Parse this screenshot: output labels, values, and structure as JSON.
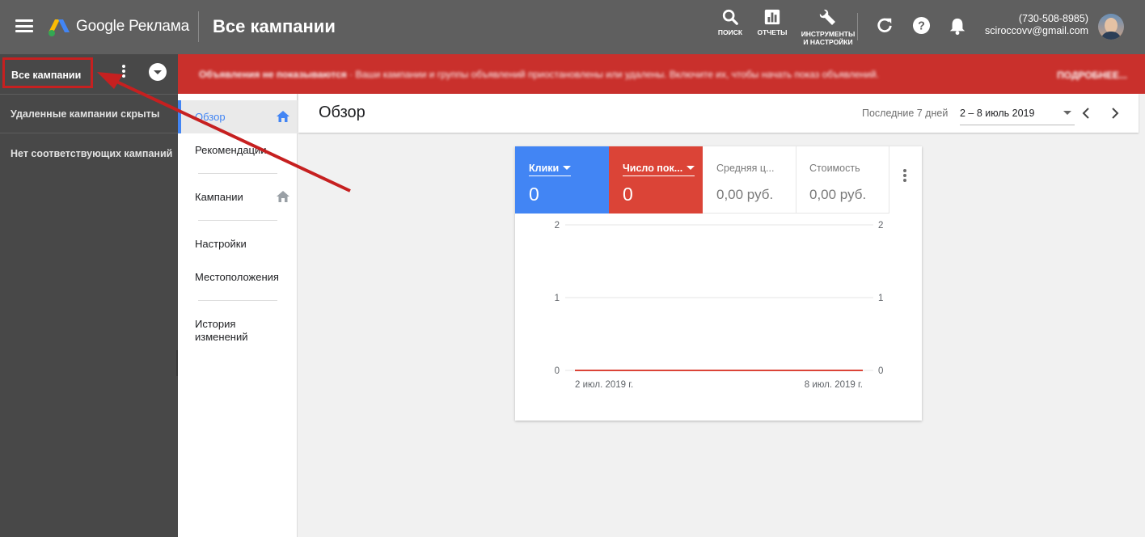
{
  "header": {
    "brand": "Google Реклама",
    "page_title": "Все кампании",
    "tools": [
      {
        "label": "ПОИСК",
        "icon": "search-icon"
      },
      {
        "label": "ОТЧЕТЫ",
        "icon": "reports-icon"
      },
      {
        "label": "ИНСТРУМЕНТЫ\nИ НАСТРОЙКИ",
        "icon": "wrench-icon"
      }
    ],
    "icons": [
      "refresh-icon",
      "help-icon",
      "notifications-icon"
    ],
    "account": {
      "phone": "(730-508-8985)",
      "email": "sciroccovv@gmail.com"
    }
  },
  "sidebar": {
    "selector_label": "Все кампании",
    "notes": [
      "Удаленные кампании скрыты",
      "Нет соответствующих кампаний"
    ]
  },
  "alert": {
    "title": "Объявления не показываются",
    "message": "· Ваши кампании и группы объявлений приостановлены или удалены. Включите их, чтобы начать показ объявлений.",
    "action": "ПОДРОБНЕЕ..."
  },
  "nav": {
    "items": [
      {
        "label": "Обзор",
        "active": true
      },
      {
        "label": "Рекомендации"
      },
      {
        "label": "Кампании"
      },
      {
        "label": "Настройки"
      },
      {
        "label": "Местоположения"
      },
      {
        "label": "История изменений"
      }
    ]
  },
  "main": {
    "title": "Обзор",
    "range_label": "Последние 7 дней",
    "range_value": "2 – 8 июль 2019"
  },
  "card": {
    "metrics": [
      {
        "label": "Клики",
        "value": "0",
        "color": "#4285f4"
      },
      {
        "label": "Число пок...",
        "value": "0",
        "color": "#db4437"
      },
      {
        "label": "Средняя ц...",
        "value": "0,00 руб."
      },
      {
        "label": "Стоимость",
        "value": "0,00 руб."
      }
    ]
  },
  "chart_data": {
    "type": "line",
    "x": [
      "2 июл. 2019 г.",
      "8 июл. 2019 г."
    ],
    "x_tick_labels": [
      "2 июл. 2019 г.",
      "8 июл. 2019 г."
    ],
    "series": [
      {
        "name": "Клики",
        "values": [
          0,
          0
        ],
        "color": "#4285f4"
      },
      {
        "name": "Число пок...",
        "values": [
          0,
          0
        ],
        "color": "#db4437"
      }
    ],
    "y_ticks_left": [
      "2",
      "1",
      "0"
    ],
    "y_ticks_right": [
      "2",
      "1",
      "0"
    ],
    "ylim": [
      0,
      2
    ],
    "grid": true
  }
}
